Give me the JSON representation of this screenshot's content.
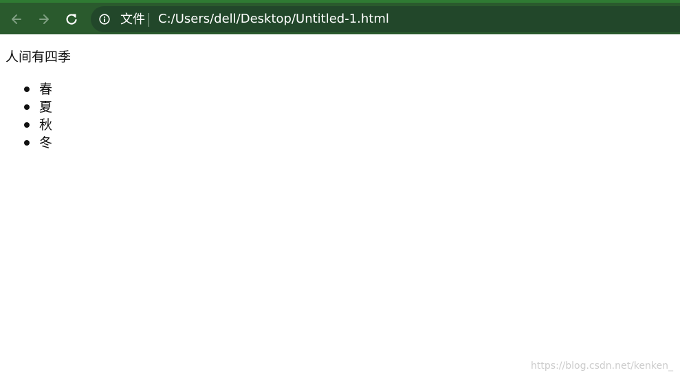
{
  "browser": {
    "scheme_label": "文件",
    "address": "C:/Users/dell/Desktop/Untitled-1.html",
    "icons": {
      "back": "arrow-left-icon",
      "forward": "arrow-right-icon",
      "reload": "reload-icon",
      "site_info": "info-icon"
    },
    "colors": {
      "toolbar": "#2a5a2d",
      "omnibox": "#22472a"
    }
  },
  "page": {
    "heading": "人间有四季",
    "seasons": [
      "春",
      "夏",
      "秋",
      "冬"
    ]
  },
  "watermark": "https://blog.csdn.net/kenken_"
}
